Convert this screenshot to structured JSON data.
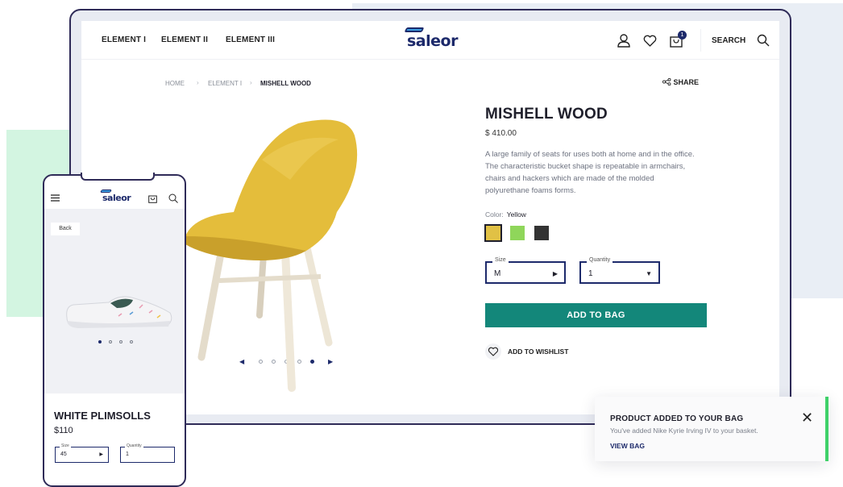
{
  "desktop": {
    "nav": [
      "ELEMENT I",
      "ELEMENT II",
      "ELEMENT III"
    ],
    "logo": "saleor",
    "cart_count": "1",
    "search_label": "SEARCH",
    "breadcrumbs": {
      "home": "HOME",
      "category": "ELEMENT I",
      "current": "MISHELL WOOD",
      "separator": "›"
    },
    "share_label": "SHARE",
    "product": {
      "title": "MISHELL WOOD",
      "price": "$ 410.00",
      "description": "A large family of seats for uses both at home and in the office. The characteristic bucket shape is repeatable in armchairs, chairs and hackers which are made of the molded polyurethane foams forms.",
      "color_label": "Color:",
      "color_value": "Yellow",
      "swatches": [
        "#e1c145",
        "#8fd65a",
        "#333333"
      ],
      "size_label": "Size",
      "size_value": "M",
      "quantity_label": "Quantity",
      "quantity_value": "1",
      "add_button": "ADD TO BAG",
      "wishlist_label": "ADD TO WISHLIST"
    },
    "gallery": {
      "dot_count": 5,
      "active_dot": 5
    }
  },
  "mobile": {
    "logo": "saleor",
    "back_label": "Back",
    "product_title": "WHITE PLIMSOLLS",
    "price": "$110",
    "size_label": "Size",
    "size_value": "45",
    "quantity_label": "Quantity",
    "quantity_value": "1",
    "gallery": {
      "dot_count": 4,
      "active_dot": 1
    }
  },
  "toast": {
    "title": "PRODUCT ADDED TO YOUR BAG",
    "message": "You've added Nike Kyrie Irving IV to your basket.",
    "link": "VIEW BAG",
    "close": "✕"
  },
  "colors": {
    "accent": "#13877a",
    "navy": "#1d2a6b",
    "success": "#3ed169"
  }
}
